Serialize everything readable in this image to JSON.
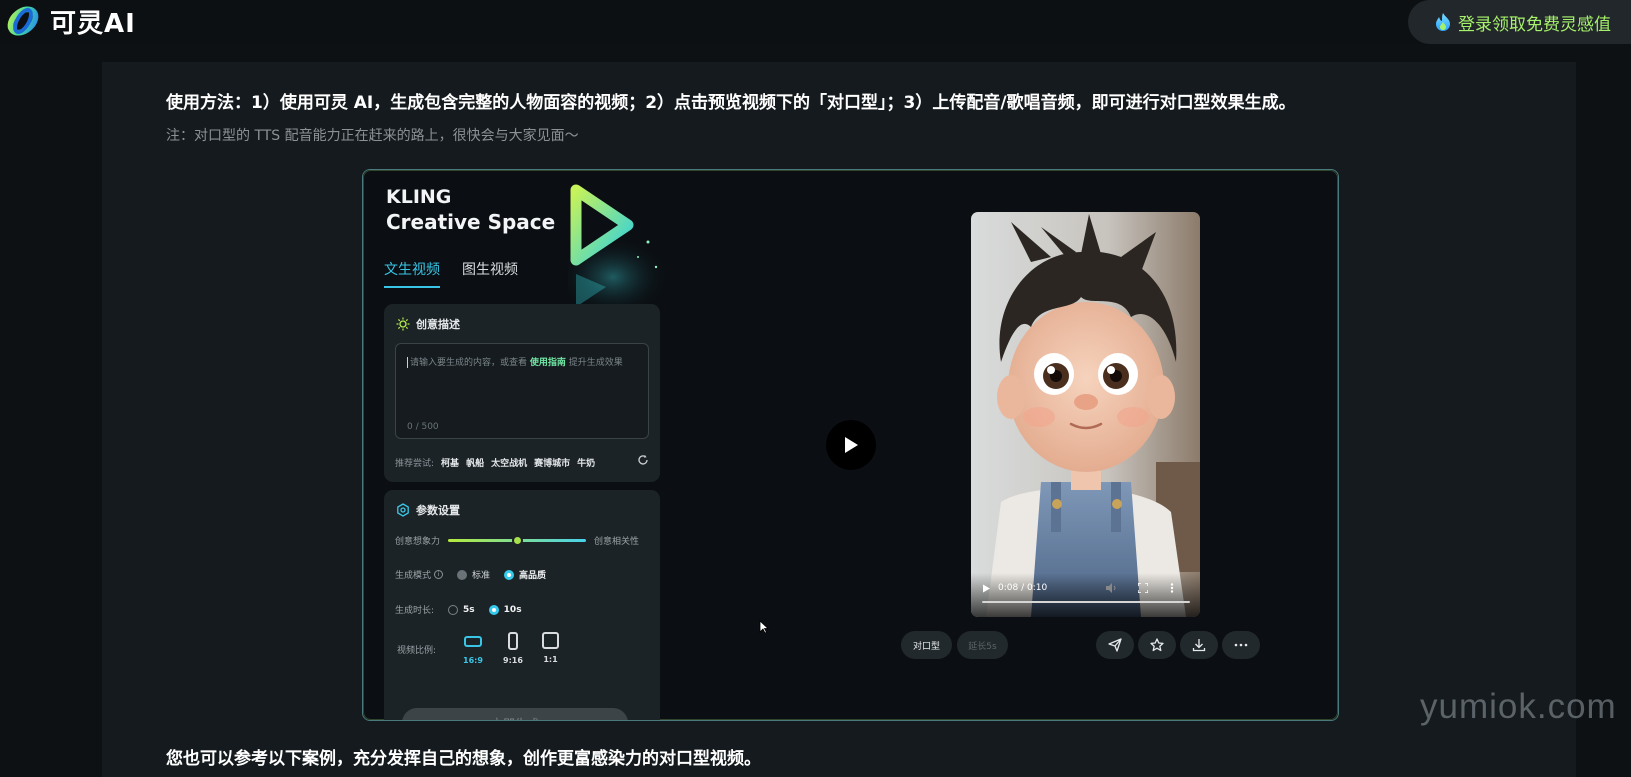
{
  "header": {
    "logo_text": "可灵AI",
    "login_label": "登录领取免费灵感值",
    "login_color": "#a6f16b"
  },
  "article": {
    "usage_text": "使用方法：1）使用可灵 AI，生成包含完整的人物面容的视频；2）点击预览视频下的「对口型」；3）上传配音/歌唱音频，即可进行对口型效果生成。",
    "note_text": "注：对口型的 TTS 配音能力正在赶来的路上，很快会与大家见面～",
    "footer_text": "您也可以参考以下案例，充分发挥自己的想象，创作更富感染力的对口型视频。"
  },
  "preview": {
    "brand_line1": "KLING",
    "brand_line2": "Creative Space",
    "tabs": [
      {
        "label": "文生视频",
        "active": true
      },
      {
        "label": "图生视频",
        "active": false
      }
    ],
    "prompt_card": {
      "title": "创意描述",
      "placeholder_pre": "请输入要生成的内容，或查看",
      "placeholder_link": "使用指南",
      "placeholder_post": "提升生成效果",
      "counter": "0 / 500",
      "suggest_label": "推荐尝试:",
      "suggestions": [
        "柯基",
        "帆船",
        "太空战机",
        "赛博城市",
        "牛奶"
      ]
    },
    "params_card": {
      "title": "参数设置",
      "slider_left": "创意想象力",
      "slider_right": "创意相关性",
      "slider_value": 0.5,
      "mode_label": "生成模式",
      "mode_options": [
        "标准",
        "高品质"
      ],
      "mode_selected": "高品质",
      "duration_label": "生成时长:",
      "duration_options": [
        "5s",
        "10s"
      ],
      "duration_selected": "10s",
      "ratio_label": "视频比例:",
      "ratios": [
        "16:9",
        "9:16",
        "1:1"
      ],
      "ratio_selected": "16:9",
      "generate_label": "立即生成",
      "peek_label": "生"
    },
    "video": {
      "time": "0:08 / 0:10",
      "progress": 1.0
    },
    "actions": {
      "lip_sync": "对口型",
      "extend": "延长5s",
      "icons": [
        "send-icon",
        "star-icon",
        "download-icon",
        "more-icon"
      ]
    },
    "accent": "#39c6e6"
  },
  "watermark": "yumiok.com"
}
